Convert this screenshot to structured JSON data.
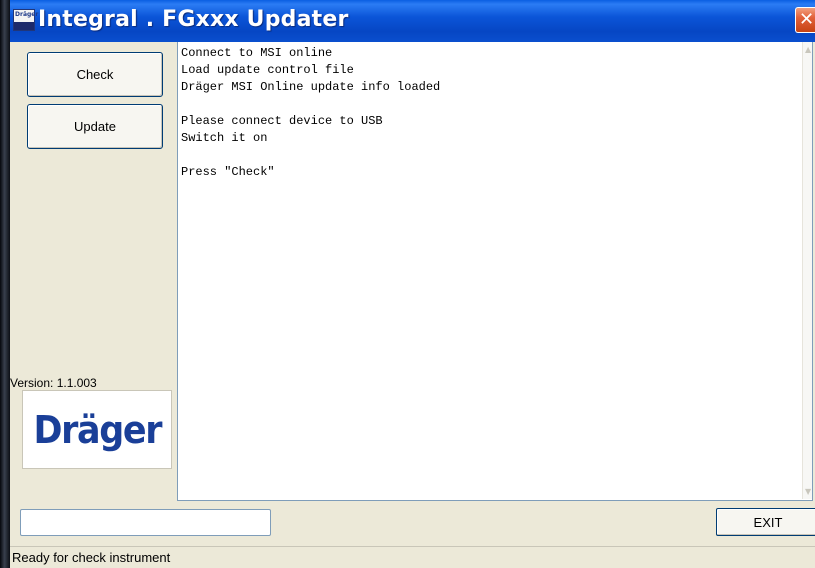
{
  "window": {
    "title": "Integral . FGxxx  Updater",
    "close_glyph": "✕"
  },
  "app_icon": {
    "name": "drager-app-icon",
    "text": "Dräger"
  },
  "buttons": {
    "check_label": "Check",
    "update_label": "Update",
    "exit_label": "EXIT"
  },
  "log": {
    "lines": [
      "Connect to MSI online",
      "Load update control file",
      "Dräger MSI Online update info loaded",
      "",
      "Please connect device to USB",
      "Switch it on",
      "",
      "Press \"Check\""
    ]
  },
  "version_label": "Version: 1.1.003",
  "logo": {
    "text": "Dräger",
    "color": "#1a3f98"
  },
  "progress": {
    "value": 0
  },
  "status": {
    "text": "Ready for check instrument"
  },
  "colors": {
    "titlebar": "#0b55d8",
    "close_button": "#e2613b",
    "window_bg": "#ece9d8"
  }
}
